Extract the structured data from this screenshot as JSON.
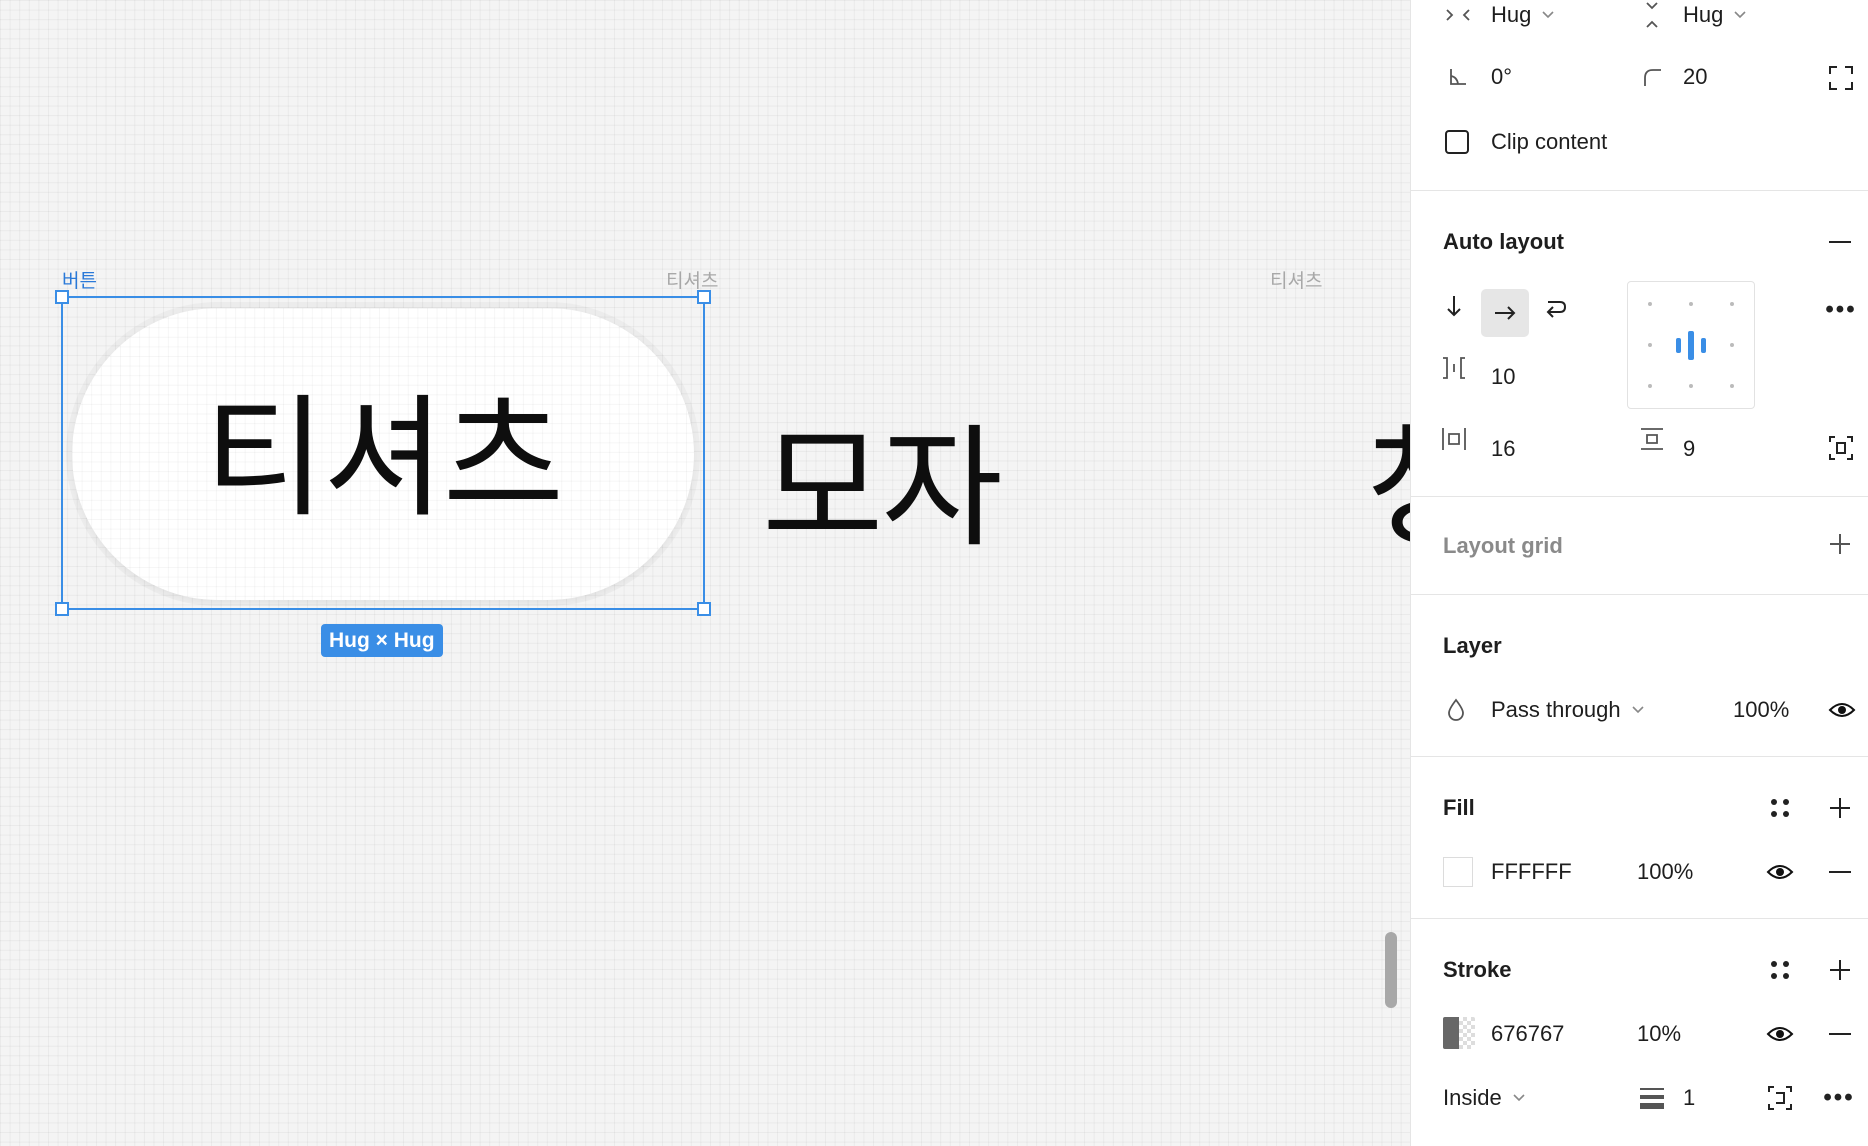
{
  "canvas": {
    "frame_labels": {
      "selected": "버튼",
      "second": "티셔츠",
      "third": "티셔츠"
    },
    "button_text": "티셔츠",
    "second_text": "모자",
    "third_text_partial": "청",
    "size_badge": "Hug × Hug",
    "accent_color": "#3a8ee6"
  },
  "panel": {
    "sizing": {
      "width_mode": "Hug",
      "height_mode": "Hug",
      "rotation": "0°",
      "corner_radius": "20",
      "clip_content_label": "Clip content",
      "clip_content_checked": false
    },
    "auto_layout": {
      "title": "Auto layout",
      "direction": "horizontal",
      "gap": "10",
      "padding_horizontal": "16",
      "padding_vertical": "9",
      "alignment": "center"
    },
    "layout_grid": {
      "title": "Layout grid"
    },
    "layer": {
      "title": "Layer",
      "blend_mode": "Pass through",
      "opacity": "100%"
    },
    "fill": {
      "title": "Fill",
      "hex": "FFFFFF",
      "opacity": "100%",
      "color": "#ffffff"
    },
    "stroke": {
      "title": "Stroke",
      "hex": "676767",
      "opacity": "10%",
      "color": "#676767",
      "position": "Inside",
      "weight": "1"
    }
  }
}
